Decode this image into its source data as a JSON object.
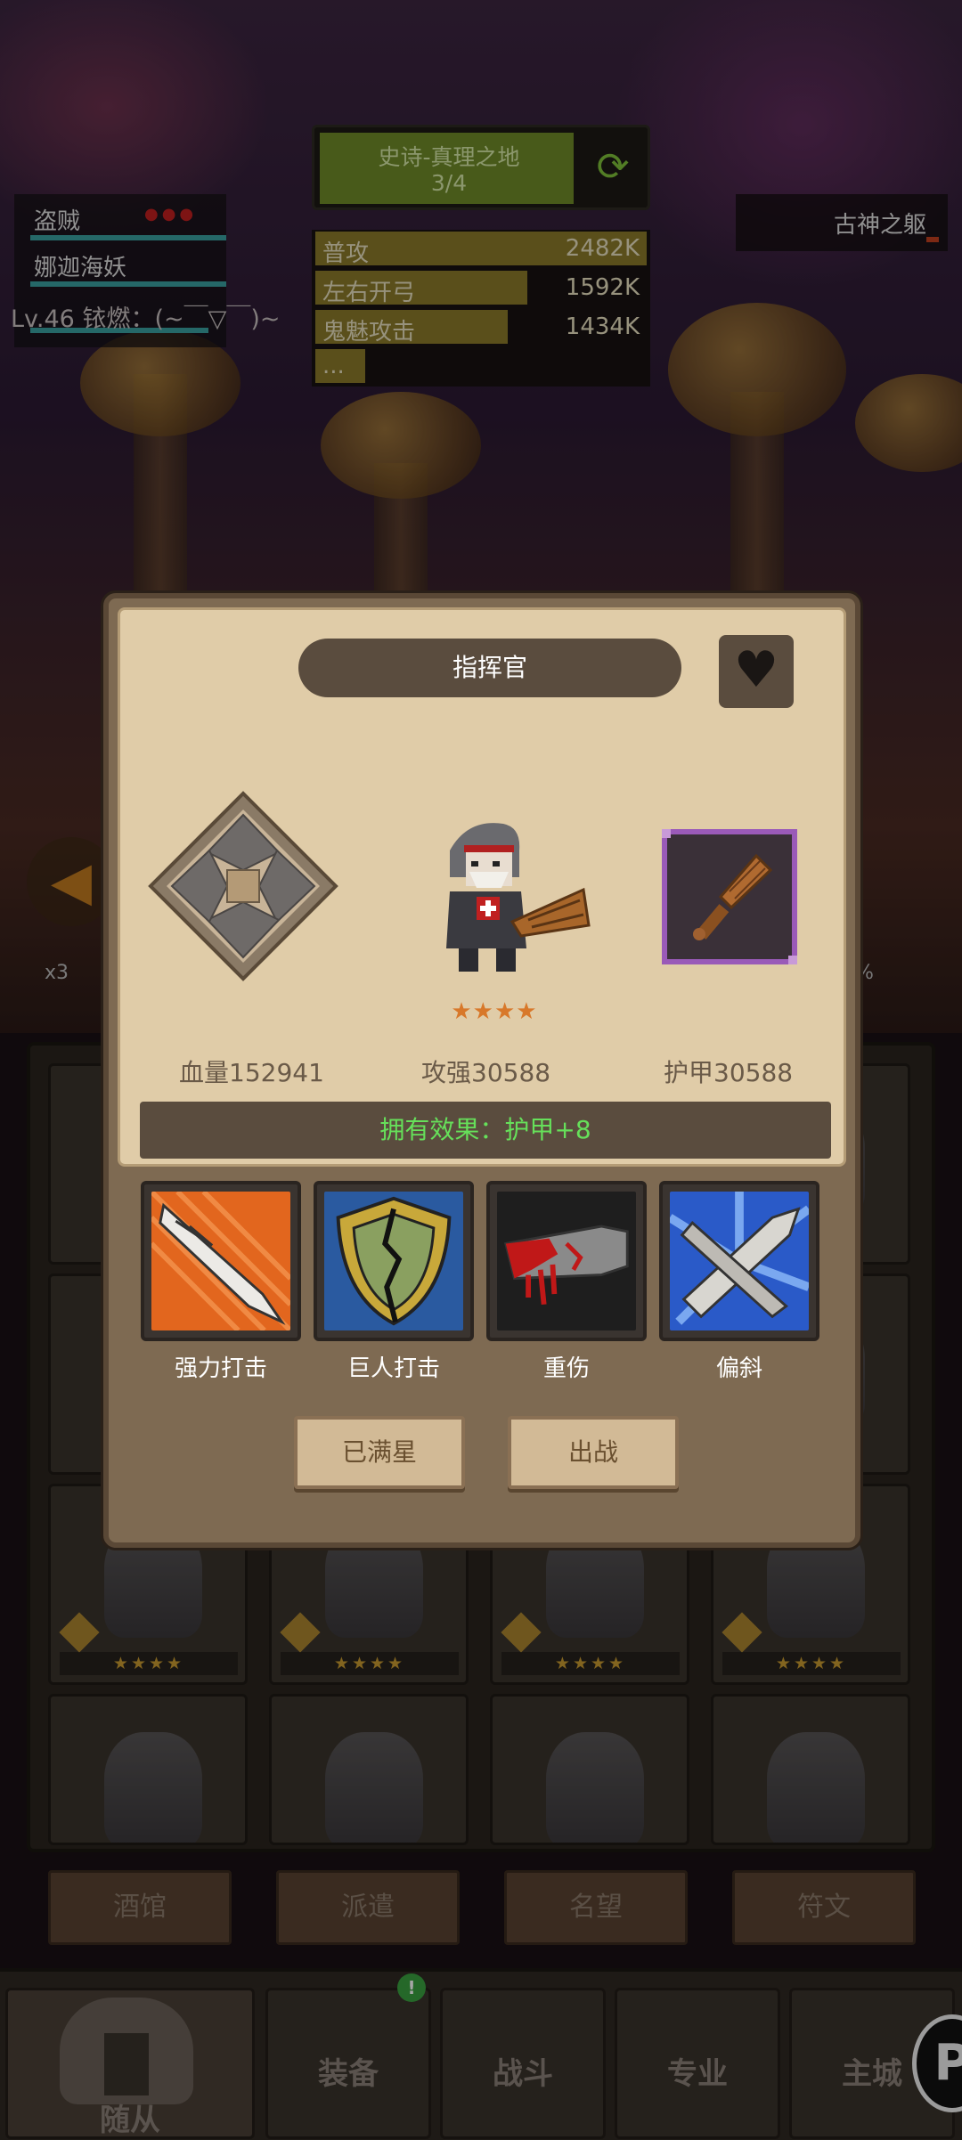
{
  "hud": {
    "stage_name": "史诗-真理之地",
    "stage_progress": "3/4",
    "damage": [
      {
        "label": "普攻",
        "value": "2482K",
        "fill": 1.0
      },
      {
        "label": "左右开弓",
        "value": "1592K",
        "fill": 0.64
      },
      {
        "label": "鬼魅攻击",
        "value": "1434K",
        "fill": 0.58
      },
      {
        "label": "...",
        "value": "",
        "fill": 0.1
      }
    ],
    "enemies": [
      "盗贼",
      "娜迦海妖"
    ],
    "enemy_dots": "●●●",
    "chat_line": "Lv.46 铱燃：(~￣▽￣)~",
    "boss_name": "古神之躯",
    "x3": "x3",
    "pct": "%"
  },
  "modal": {
    "title": "指挥官",
    "hero_stars": "★★★★",
    "stats": {
      "hp": "血量152941",
      "attack": "攻强30588",
      "armor": "护甲30588"
    },
    "effect": "拥有效果：护甲+8",
    "skills": [
      {
        "name": "强力打击"
      },
      {
        "name": "巨人打击"
      },
      {
        "name": "重伤"
      },
      {
        "name": "偏斜"
      }
    ],
    "buttons": {
      "max_star": "已满星",
      "deploy": "出战"
    }
  },
  "roster": {
    "star_text": "★★★★"
  },
  "subnav": [
    "酒馆",
    "派遣",
    "名望",
    "符文"
  ],
  "bottom_nav": [
    "随从",
    "装备",
    "战斗",
    "专业",
    "主城"
  ],
  "badge": "!",
  "float_button": "P",
  "colors": {
    "effect_text": "#66e05a",
    "weapon_frame": "#9a5ab8",
    "star": "#d8782a"
  }
}
